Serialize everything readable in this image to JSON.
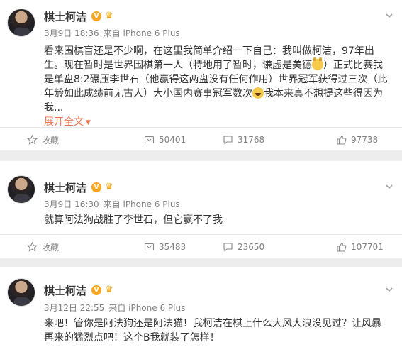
{
  "posts": [
    {
      "user": "棋士柯洁",
      "v_badge": "V",
      "time": "3月9日 18:36",
      "source": "来自 iPhone 6 Plus",
      "text_parts": [
        "看来围棋盲还是不少啊，在这里我简单介绍一下自己：我叫做柯洁，97年出生。现在暂时是世界围棋第一人（特地用了暂时，谦虚是美德",
        "）正式比赛我是单盘8:2碾压李世石（他赢得这两盘没有任何作用）世界冠军获得过三次（此年龄如此成绩前无古人）大小国内赛事冠军数次",
        "我本来真不想提这些得因为我..."
      ],
      "emoji_1": "doge-emoji",
      "emoji_2": "laugh-cry-emoji",
      "expand_label": "展开全文",
      "actions": {
        "favorite": "收藏",
        "repost": "50401",
        "comment": "31768",
        "like": "97738"
      }
    },
    {
      "user": "棋士柯洁",
      "v_badge": "V",
      "time": "3月9日 16:30",
      "source": "来自 iPhone 6 Plus",
      "text": "就算阿法狗战胜了李世石，但它赢不了我",
      "actions": {
        "favorite": "收藏",
        "repost": "35483",
        "comment": "23650",
        "like": "107701"
      }
    },
    {
      "user": "棋士柯洁",
      "v_badge": "V",
      "time": "3月12日 22:55",
      "source": "来自 iPhone 6 Plus",
      "text": "来吧！管你是阿法狗还是阿法猫！我柯洁在棋上什么大风大浪没见过？让风暴再来的猛烈点吧！这个B我就装了怎样！"
    }
  ],
  "colors": {
    "accent": "#eb7350",
    "meta": "#808080",
    "badge": "#f5a623",
    "background": "#ededed"
  },
  "icons": [
    "chevron-down-icon",
    "favorite-icon",
    "repost-icon",
    "comment-icon",
    "like-icon",
    "verified-badge-icon",
    "crown-icon"
  ]
}
